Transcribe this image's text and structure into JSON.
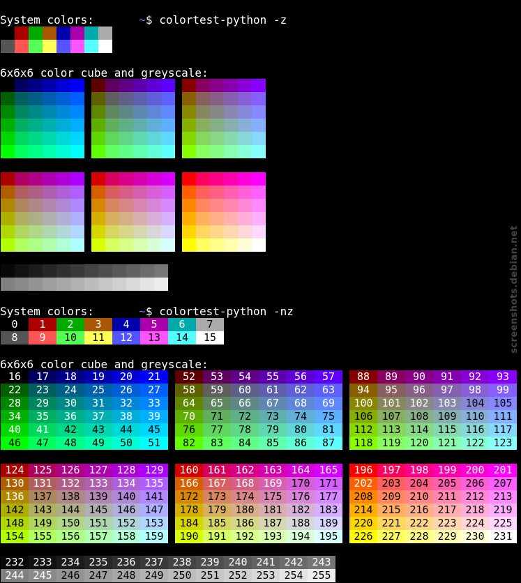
{
  "session": {
    "prompt_tilde": "~",
    "prompt_symbol": "$",
    "command1": "colortest-python -z",
    "command2": "colortest-python -nz"
  },
  "labels": {
    "system_colors": "System colors:",
    "cube_and_greyscale": "6x6x6 color cube and greyscale:"
  },
  "system_colors": [
    "#000000",
    "#aa0000",
    "#00aa00",
    "#aa5500",
    "#0000aa",
    "#aa00aa",
    "#00aaaa",
    "#aaaaaa",
    "#555555",
    "#ff5555",
    "#55ff55",
    "#ffff55",
    "#5555ff",
    "#ff55ff",
    "#55ffff",
    "#ffffff"
  ],
  "cube_levels": [
    0,
    95,
    135,
    175,
    215,
    255
  ],
  "greyscale": {
    "start": 232,
    "end": 255
  },
  "watermark": "screenshots.debian.net"
}
